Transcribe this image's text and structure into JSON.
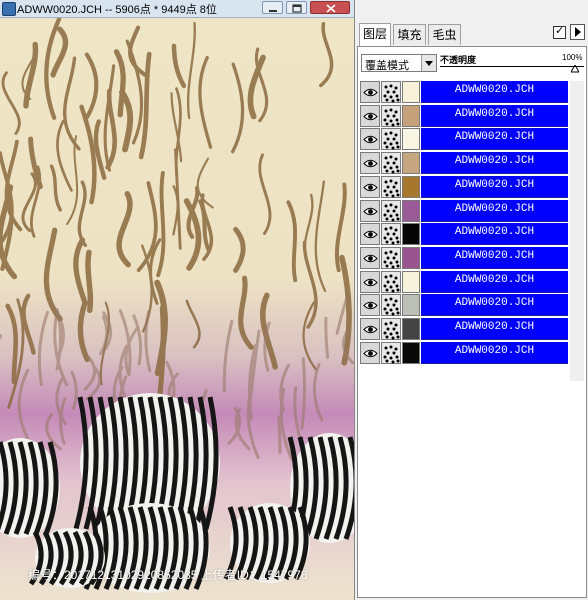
{
  "window": {
    "title": "ADWW0020.JCH -- 5906点 * 9449点 8位"
  },
  "panel": {
    "tabs": [
      {
        "label": "图层",
        "active": true
      },
      {
        "label": "填充",
        "active": false
      },
      {
        "label": "毛虫",
        "active": false
      }
    ],
    "checkbox_mark": "✓",
    "blend_mode": "覆盖模式",
    "opacity_label": "不透明度",
    "opacity_value": "100%",
    "layers": [
      {
        "name": "ADWW0020.JCH",
        "color": "#f6f1d8"
      },
      {
        "name": "ADWW0020.JCH",
        "color": "#c7a17c"
      },
      {
        "name": "ADWW0020.JCH",
        "color": "#f9f5e5"
      },
      {
        "name": "ADWW0020.JCH",
        "color": "#c6a680"
      },
      {
        "name": "ADWW0020.JCH",
        "color": "#a5782e"
      },
      {
        "name": "ADWW0020.JCH",
        "color": "#9a5a98"
      },
      {
        "name": "ADWW0020.JCH",
        "color": "#050505"
      },
      {
        "name": "ADWW0020.JCH",
        "color": "#9a5590"
      },
      {
        "name": "ADWW0020.JCH",
        "color": "#f5f3dc"
      },
      {
        "name": "ADWW0020.JCH",
        "color": "#bcbfb8"
      },
      {
        "name": "ADWW0020.JCH",
        "color": "#444444"
      },
      {
        "name": "ADWW0020.JCH",
        "color": "#080808"
      }
    ]
  },
  "watermark": "编号：20171213102920852035 上传者ID：1547978",
  "colors": {
    "selection_blue": "#0000ff",
    "background_cream": "#efe6c6",
    "stripe_brown": "#8b6a3f",
    "pink": "#c48ab8",
    "purple": "#8a4f86"
  }
}
